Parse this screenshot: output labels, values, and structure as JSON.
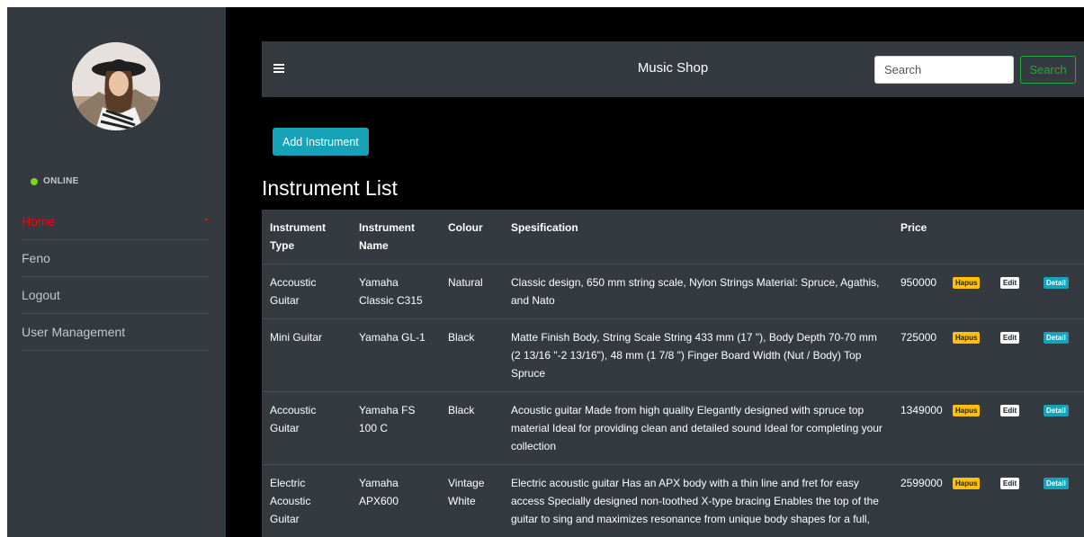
{
  "sidebar": {
    "status": "ONLINE",
    "items": [
      {
        "label": "Home"
      },
      {
        "label": "Feno"
      },
      {
        "label": "Logout"
      },
      {
        "label": "User Management"
      }
    ]
  },
  "navbar": {
    "brand": "Music Shop",
    "search_placeholder": "Search",
    "search_button": "Search"
  },
  "main": {
    "add_button": "Add Instrument",
    "title": "Instrument List"
  },
  "table": {
    "headers": [
      "Instrument Type",
      "Instrument Name",
      "Colour",
      "Spesification",
      "Price"
    ],
    "action_labels": {
      "delete": "Hapus",
      "edit": "Edit",
      "detail": "Detail"
    },
    "rows": [
      {
        "type": "Accoustic Guitar",
        "name": "Yamaha Classic C315",
        "colour": "Natural",
        "spec": "Classic design, 650 mm string scale, Nylon Strings Material: Spruce, Agathis, and Nato",
        "price": "950000"
      },
      {
        "type": "Mini Guitar",
        "name": "Yamaha GL-1",
        "colour": "Black",
        "spec": "Matte Finish Body, String Scale String 433 mm (17 \"), Body Depth 70-70 mm (2 13/16 \"-2 13/16\"), 48 mm (1 7/8 \") Finger Board Width (Nut / Body) Top Spruce",
        "price": "725000"
      },
      {
        "type": "Accoustic Guitar",
        "name": "Yamaha FS 100 C",
        "colour": "Black",
        "spec": "Acoustic guitar Made from high quality Elegantly designed with spruce top material Ideal for providing clean and detailed sound Ideal for completing your collection",
        "price": "1349000"
      },
      {
        "type": "Electric Acoustic Guitar",
        "name": "Yamaha APX600",
        "colour": "Vintage White",
        "spec": "Electric acoustic guitar Has an APX body with a thin line and fret for easy access Specially designed non-toothed X-type bracing Enables the top of the guitar to sing and maximizes resonance from unique body shapes for a full,",
        "price": "2599000"
      }
    ]
  }
}
